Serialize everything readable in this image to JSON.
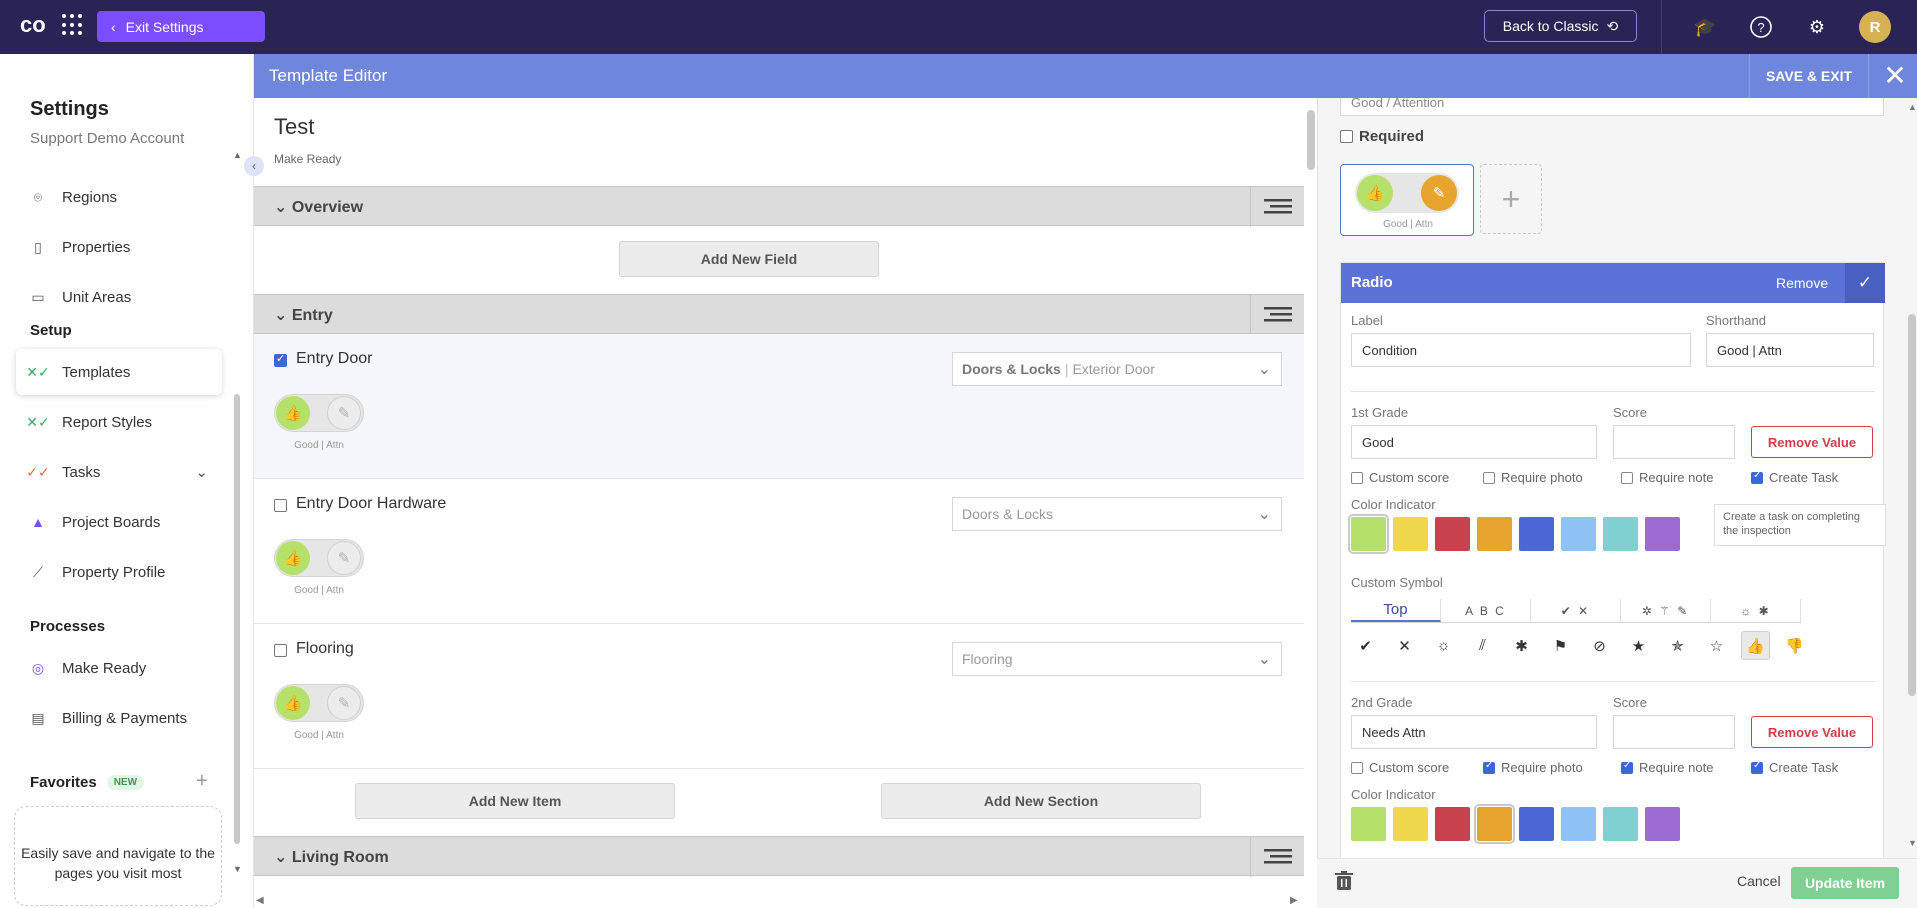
{
  "topbar": {
    "logo_text": "co",
    "exit_settings_label": "Exit Settings",
    "back_classic_label": "Back to Classic",
    "avatar_initial": "R"
  },
  "sidebar": {
    "title": "Settings",
    "account": "Support Demo Account",
    "items_top": [
      {
        "label": "Regions",
        "icon": "pin-icon"
      },
      {
        "label": "Properties",
        "icon": "building-icon"
      },
      {
        "label": "Unit Areas",
        "icon": "door-icon"
      }
    ],
    "setup_heading": "Setup",
    "setup_items": [
      {
        "label": "Templates",
        "icon": "templates-icon",
        "active": true
      },
      {
        "label": "Report Styles",
        "icon": "report-styles-icon"
      },
      {
        "label": "Tasks",
        "icon": "tasks-icon"
      },
      {
        "label": "Project Boards",
        "icon": "project-boards-icon"
      },
      {
        "label": "Property Profile",
        "icon": "chart-icon"
      }
    ],
    "processes_heading": "Processes",
    "process_items": [
      {
        "label": "Make Ready",
        "icon": "make-ready-icon"
      },
      {
        "label": "Billing & Payments",
        "icon": "card-icon"
      }
    ],
    "favorites_heading": "Favorites",
    "favorites_badge": "NEW",
    "favorites_empty": "Easily save and navigate to the pages you visit most"
  },
  "editor": {
    "header_title": "Template Editor",
    "save_exit_label": "SAVE & EXIT"
  },
  "template": {
    "name": "Test",
    "type": "Make Ready",
    "sections": [
      {
        "label": "Overview"
      },
      {
        "label": "Entry"
      },
      {
        "label": "Living Room"
      }
    ],
    "add_new_field_label": "Add New Field",
    "add_new_item_label": "Add New Item",
    "add_new_section_label": "Add New Section",
    "items": [
      {
        "name": "Entry Door",
        "checked": true,
        "category": "Doors & Locks",
        "subcategory": "Exterior Door",
        "toggle_label": "Good | Attn"
      },
      {
        "name": "Entry Door Hardware",
        "checked": false,
        "category": "Doors & Locks",
        "subcategory": "",
        "toggle_label": "Good | Attn"
      },
      {
        "name": "Flooring",
        "checked": false,
        "category": "Flooring",
        "subcategory": "",
        "toggle_label": "Good | Attn"
      }
    ]
  },
  "right_panel": {
    "top_input_value": "Good / Attention",
    "required_label": "Required",
    "radio_chip_label": "Good | Attn",
    "radio_card": {
      "title": "Radio",
      "remove_label": "Remove",
      "label_label": "Label",
      "label_value": "Condition",
      "shorthand_label": "Shorthand",
      "shorthand_value": "Good | Attn",
      "grades": [
        {
          "grade_label": "1st Grade",
          "grade_value": "Good",
          "score_label": "Score",
          "score_value": "",
          "remove_value_label": "Remove Value",
          "custom_score": false,
          "require_photo": false,
          "require_note": false,
          "create_task": true,
          "color_selected": "#b5e16a"
        },
        {
          "grade_label": "2nd Grade",
          "grade_value": "Needs Attn",
          "score_label": "Score",
          "score_value": "",
          "remove_value_label": "Remove Value",
          "custom_score": false,
          "require_photo": true,
          "require_note": true,
          "create_task": true,
          "color_selected": "#e7a530"
        }
      ],
      "checkbox_labels": {
        "custom_score": "Custom score",
        "require_photo": "Require photo",
        "require_note": "Require note",
        "create_task": "Create Task"
      },
      "color_indicator_label": "Color Indicator",
      "colors": [
        "#b5e16a",
        "#f0d84c",
        "#c8424f",
        "#e7a530",
        "#4e67d6",
        "#8fc3f6",
        "#7fd0d0",
        "#9b6bd1"
      ],
      "custom_symbol_label": "Custom Symbol",
      "symbol_tabs": [
        "Top",
        "A B C",
        "✔ ✕",
        "✲ ⚚ ✎",
        "☼ ✱"
      ],
      "symbols": [
        "✔",
        "✕",
        "☼",
        "⫽",
        "✱",
        "⚑",
        "⊘",
        "★",
        "✯",
        "☆",
        "👍",
        "👎"
      ],
      "selected_symbol_index": 10
    },
    "tooltip_text": "Create a task on completing the inspection",
    "cancel_label": "Cancel",
    "update_label": "Update Item"
  }
}
